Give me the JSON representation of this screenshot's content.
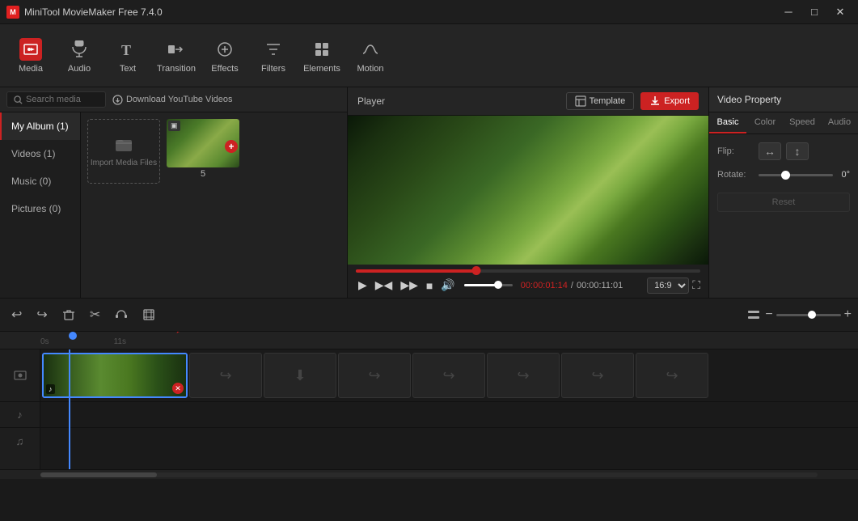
{
  "app": {
    "title": "MiniTool MovieMaker Free 7.4.0",
    "icon_label": "M"
  },
  "title_bar": {
    "controls": [
      "minimize",
      "maximize",
      "close"
    ]
  },
  "toolbar": {
    "items": [
      {
        "id": "media",
        "label": "Media",
        "active": true
      },
      {
        "id": "audio",
        "label": "Audio",
        "active": false
      },
      {
        "id": "text",
        "label": "Text",
        "active": false
      },
      {
        "id": "transition",
        "label": "Transition",
        "active": false
      },
      {
        "id": "effects",
        "label": "Effects",
        "active": false
      },
      {
        "id": "filters",
        "label": "Filters",
        "active": false
      },
      {
        "id": "elements",
        "label": "Elements",
        "active": false
      },
      {
        "id": "motion",
        "label": "Motion",
        "active": false
      }
    ]
  },
  "left_panel": {
    "search_placeholder": "Search media",
    "download_btn": "Download YouTube Videos",
    "sidebar": [
      {
        "label": "My Album (1)",
        "active": true
      },
      {
        "label": "Videos (1)",
        "active": false
      },
      {
        "label": "Music (0)",
        "active": false
      },
      {
        "label": "Pictures (0)",
        "active": false
      }
    ],
    "import_label": "Import Media Files",
    "media_items": [
      {
        "id": "import",
        "type": "import",
        "label": "Import Media Files"
      },
      {
        "id": "clip1",
        "type": "video",
        "label": "5",
        "badge": "▣"
      }
    ]
  },
  "player": {
    "title": "Player",
    "template_btn": "Template",
    "export_btn": "Export",
    "time_current": "00:00:01:14",
    "time_total": "00:00:11:01",
    "progress_pct": 35,
    "volume_pct": 70,
    "ratio": "16:9"
  },
  "video_property": {
    "title": "Video Property",
    "tabs": [
      "Basic",
      "Color",
      "Speed",
      "Audio"
    ],
    "active_tab": "Basic",
    "flip_label": "Flip:",
    "rotate_label": "Rotate:",
    "rotate_value": "0°",
    "reset_btn": "Reset"
  },
  "timeline_toolbar": {
    "undo_label": "↩",
    "redo_label": "↪",
    "delete_label": "🗑",
    "cut_label": "✂",
    "audio_label": "◑",
    "crop_label": "⊡",
    "zoom_in": "+",
    "zoom_out": "−"
  },
  "timeline": {
    "ruler_marks": [
      "0s",
      "11s"
    ],
    "tracks": [
      {
        "type": "video",
        "icon": "🎬"
      },
      {
        "type": "audio",
        "icon": "♪"
      },
      {
        "type": "subtitle",
        "icon": "♫"
      }
    ],
    "slots": [
      {
        "icon": "↪",
        "empty": true
      },
      {
        "icon": "⬇",
        "empty": true
      },
      {
        "icon": "↪",
        "empty": true
      },
      {
        "icon": "↪",
        "empty": true
      },
      {
        "icon": "↪",
        "empty": true
      },
      {
        "icon": "↪",
        "empty": true
      },
      {
        "icon": "↪",
        "empty": true
      }
    ]
  }
}
